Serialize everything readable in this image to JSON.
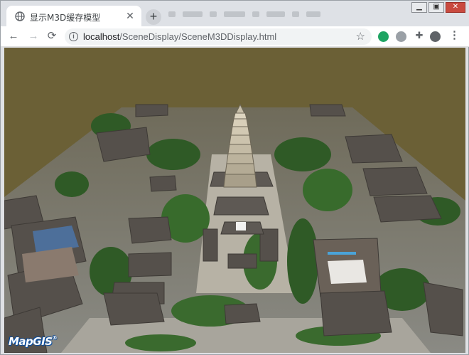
{
  "browser": {
    "tab_title": "显示M3D缓存模型",
    "tab_close_icon": "close-icon",
    "new_tab_label": "+",
    "url_host": "localhost",
    "url_path": "/SceneDisplay/SceneM3DDisplay.html",
    "back_icon": "arrow-left-icon",
    "forward_icon": "arrow-right-icon",
    "reload_icon": "reload-icon",
    "site_info_icon": "info-icon",
    "bookmark_icon": "star-icon",
    "menu_icon": "kebab-menu-icon"
  },
  "scene": {
    "sky_color": "#6b6036",
    "logo_text": "MapGIS",
    "logo_mark": "®"
  }
}
